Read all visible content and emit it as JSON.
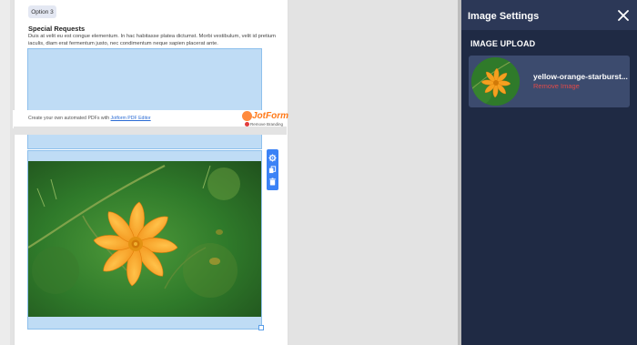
{
  "form": {
    "option_label": "Option 3",
    "special_requests_title": "Special Requests",
    "special_requests_text": "Duis at velit eu est congue elementum. In hac habitasse platea dictumst. Morbi vestibulum, velit id pretium iaculis, diam erat fermentum justo, nec condimentum neque sapien placerat ante.",
    "footer_prefix": "Create your own automated PDFs with ",
    "footer_link": "Jotform PDF Editor",
    "brand_name": "JotForm",
    "remove_branding": "Remove Branding"
  },
  "panel": {
    "title": "Image Settings",
    "section_label": "IMAGE UPLOAD",
    "file_name": "yellow-orange-starburst...",
    "remove_label": "Remove Image"
  },
  "icons": [
    "gear-icon",
    "copy-icon",
    "trash-icon",
    "close-icon"
  ],
  "colors": {
    "panel_bg": "#1f2a44",
    "panel_header": "#2c3857",
    "card_bg": "#3c4b6e",
    "accent_blue": "#3b82f6",
    "remove_red": "#e04a4a",
    "jotform_orange": "#ff7a1a"
  }
}
